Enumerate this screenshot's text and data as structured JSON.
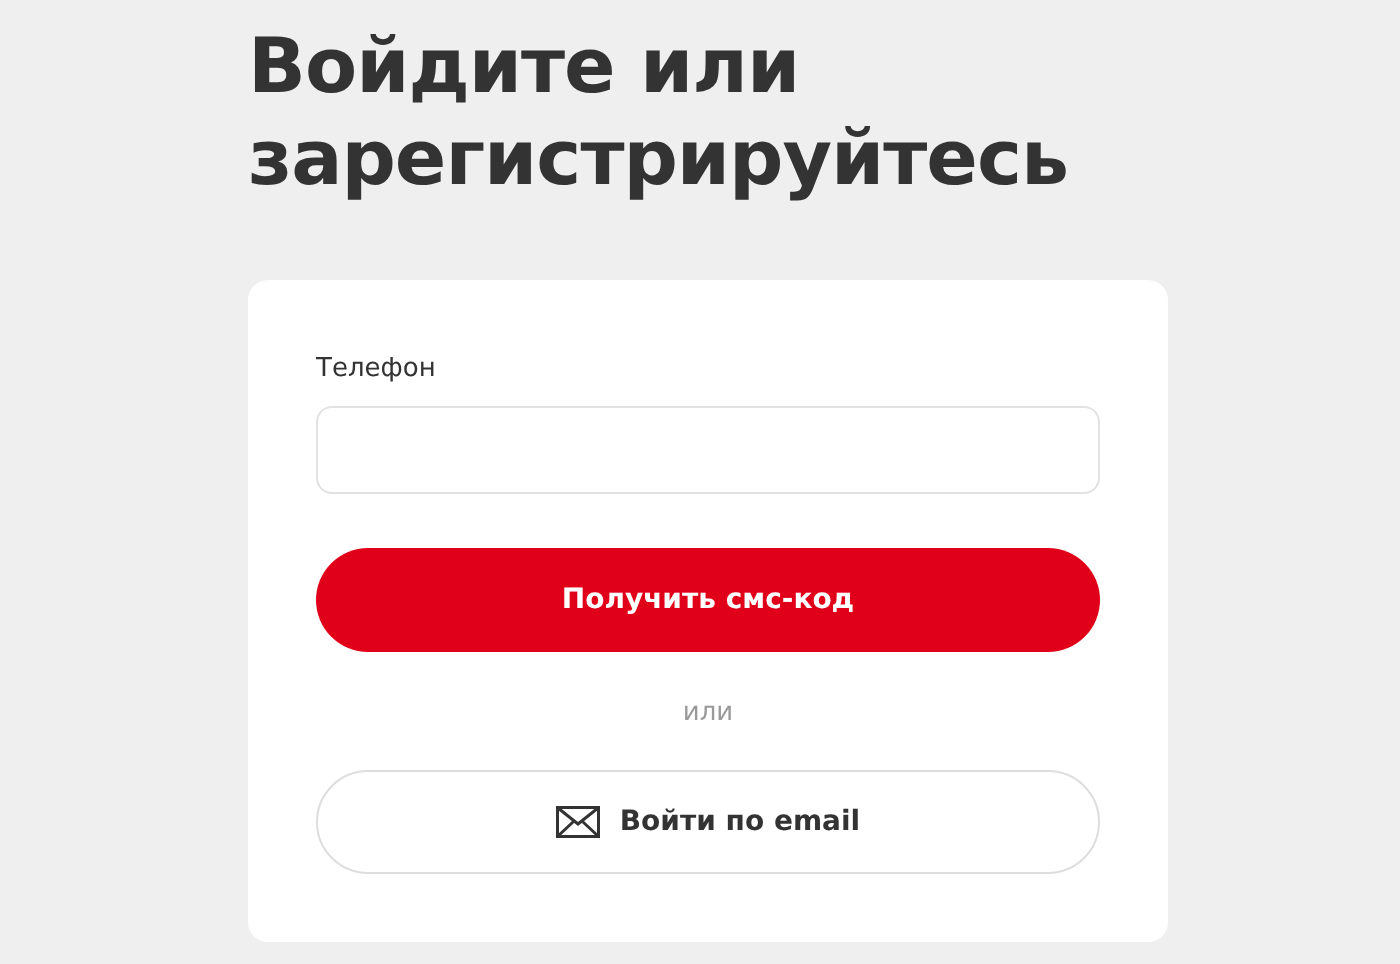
{
  "heading": "Войдите или зарегистрируйтесь",
  "form": {
    "phone_label": "Телефон",
    "submit_button": "Получить смс-код",
    "separator": "или",
    "email_button": "Войти по email"
  }
}
